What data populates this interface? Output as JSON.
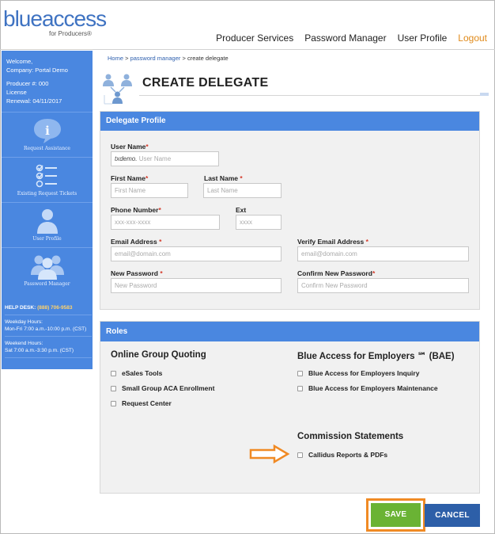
{
  "header": {
    "logo_main_1": "blue",
    "logo_main_2": "access",
    "logo_sub": "for Producers®",
    "nav": [
      "Producer Services",
      "Password Manager",
      "User Profile",
      "Logout"
    ]
  },
  "sidebar": {
    "welcome": "Welcome,",
    "company": "Company: Portal Demo",
    "producer": "Producer #: 000",
    "license": "License",
    "renewal": "Renewal: 04/11/2017",
    "items": [
      {
        "label": "Request Assistance",
        "icon": "info-icon"
      },
      {
        "label": "Existing Request Tickets",
        "icon": "checklist-icon"
      },
      {
        "label": "User Profile",
        "icon": "user-icon"
      },
      {
        "label": "Password Manager",
        "icon": "users-group-icon"
      }
    ],
    "helpdesk_label": "HELP DESK:",
    "helpdesk_number": "(888) 706-9583",
    "weekday_label": "Weekday Hours:",
    "weekday_hours": "Mon-Fri 7:00 a.m.-10:00 p.m. (CST)",
    "weekend_label": "Weekend Hours:",
    "weekend_hours": "Sat 7:00 a.m.-3:30 p.m. (CST)"
  },
  "breadcrumb": {
    "home": "Home",
    "sep": ">",
    "pm": "password manager",
    "current": "create delegate"
  },
  "page_title": "CREATE DELEGATE",
  "profile": {
    "heading": "Delegate Profile",
    "user_name_label": "User Name",
    "user_name_prefix": "txdemo.",
    "user_name_placeholder": "User Name",
    "first_name_label": "First Name",
    "first_name_placeholder": "First Name",
    "last_name_label": "Last Name",
    "last_name_placeholder": "Last Name",
    "phone_label": "Phone Number",
    "phone_placeholder": "xxx-xxx-xxxx",
    "ext_label": "Ext",
    "ext_placeholder": "xxxx",
    "email_label": "Email Address",
    "email_placeholder": "email@domain.com",
    "verify_email_label": "Verify Email Address",
    "verify_email_placeholder": "email@domain.com",
    "password_label": "New Password",
    "password_placeholder": "New Password",
    "confirm_label": "Confirm New Password",
    "confirm_placeholder": "Confirm New Password",
    "required_mark": "*"
  },
  "roles": {
    "heading": "Roles",
    "ogq_title": "Online Group Quoting",
    "ogq_items": [
      "eSales Tools",
      "Small Group ACA Enrollment",
      "Request Center"
    ],
    "bae_title": "Blue Access for Employers ℠ (BAE)",
    "bae_items": [
      "Blue Access for Employers Inquiry",
      "Blue Access for Employers Maintenance"
    ],
    "commission_title": "Commission Statements",
    "commission_items": [
      "Callidus Reports & PDFs"
    ]
  },
  "actions": {
    "save": "SAVE",
    "cancel": "CANCEL"
  },
  "colors": {
    "brand_blue": "#4a87e0",
    "save_green": "#6ab334",
    "cancel_navy": "#2d5fa8",
    "highlight_orange": "#f08a24",
    "logout_orange": "#e08a1a"
  }
}
